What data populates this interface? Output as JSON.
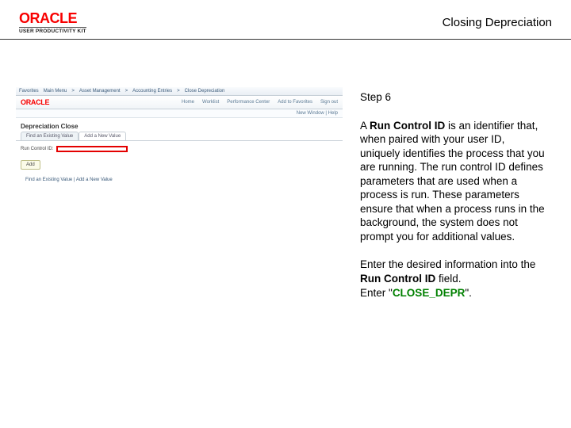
{
  "header": {
    "brand": "ORACLE",
    "tagline": "USER PRODUCTIVITY KIT",
    "title": "Closing Depreciation"
  },
  "instructions": {
    "step": "Step 6",
    "p1_a": "A ",
    "p1_b": "Run Control ID",
    "p1_c": " is an identifier that, when paired with your user ID, uniquely identifies the process that you are running. The run control ID defines parameters that are used when a process is run. These parameters ensure that when a process runs in the background, the system does not prompt you for additional values.",
    "p2_a": "Enter the desired information into the ",
    "p2_b": "Run Control ID",
    "p2_c": " field.",
    "p3_a": "Enter \"",
    "p3_b": "CLOSE_DEPR",
    "p3_c": "\"."
  },
  "app": {
    "topnav": [
      "Favorites",
      "Main Menu",
      "Asset Management",
      "Accounting Entries",
      "Close Depreciation"
    ],
    "brandnav": [
      "Home",
      "Worklist",
      "Performance Center",
      "Add to Favorites",
      "Sign out"
    ],
    "subheader": "New Window | Help",
    "page_title": "Depreciation Close",
    "tabs": [
      "Find an Existing Value",
      "Add a New Value"
    ],
    "field_label": "Run Control ID:",
    "add_button": "Add",
    "footer": "Find an Existing Value | Add a New Value"
  }
}
